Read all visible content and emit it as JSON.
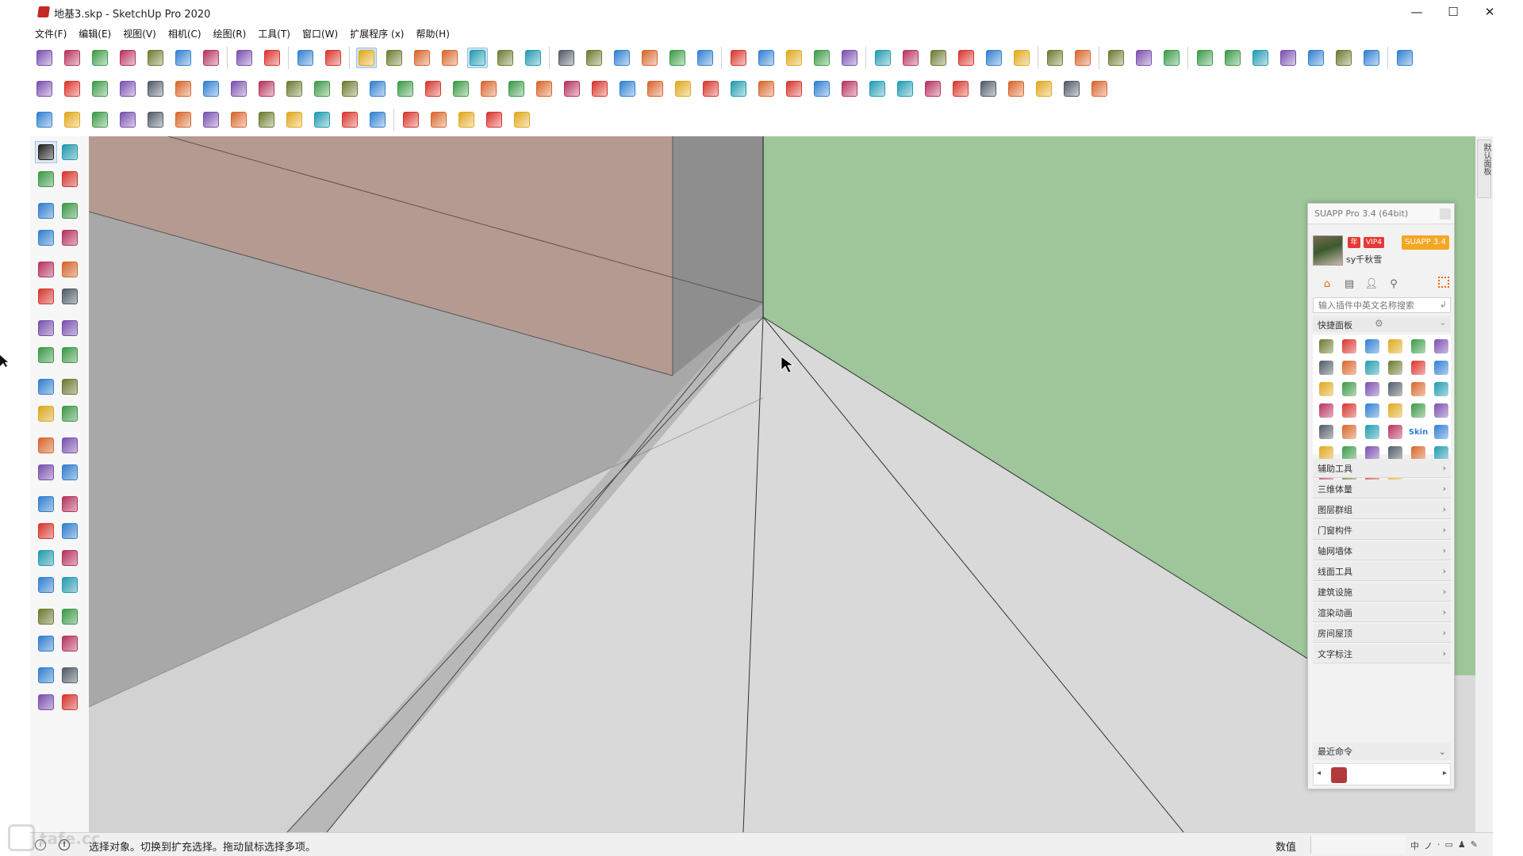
{
  "window": {
    "title": "地基3.skp - SketchUp Pro 2020",
    "minimize_glyph": "—",
    "maximize_glyph": "☐",
    "close_glyph": "✕"
  },
  "menu": [
    {
      "label": "文件(F)"
    },
    {
      "label": "编辑(E)"
    },
    {
      "label": "视图(V)"
    },
    {
      "label": "相机(C)"
    },
    {
      "label": "绘图(R)"
    },
    {
      "label": "工具(T)"
    },
    {
      "label": "窗口(W)"
    },
    {
      "label": "扩展程序 (x)"
    },
    {
      "label": "帮助(H)"
    }
  ],
  "toolbar_row1": [
    "new-icon",
    "open-icon",
    "save-icon",
    "cut-icon",
    "copy-icon",
    "paste-icon",
    "erase-icon",
    "sep",
    "undo-icon",
    "redo-icon",
    "sep",
    "print-icon",
    "model-info-icon",
    "sep",
    "xray-icon",
    "backedges-icon",
    "wireframe-icon",
    "hiddenline-icon",
    "shaded-icon",
    "textured-icon",
    "monochrome-icon",
    "sep",
    "iso-view-icon",
    "top-view-icon",
    "front-view-icon",
    "right-view-icon",
    "back-view-icon",
    "left-view-icon",
    "sep",
    "ruby-icon-1",
    "ruby-icon-2",
    "ruby-icon-3",
    "ruby-icon-4",
    "ruby-icon-5",
    "sep",
    "plugin-icon-1",
    "plugin-icon-2",
    "plugin-icon-3",
    "plugin-icon-4",
    "plugin-icon-5",
    "plugin-icon-6",
    "sep",
    "gear-icon",
    "grid-icon",
    "sep",
    "line-tool-icon",
    "dimension-icon",
    "flip-icon",
    "sep",
    "fill-icon",
    "box-icon",
    "shape-icon",
    "shape-icon-2",
    "pencil-icon",
    "scissors-icon",
    "wrench-icon",
    "sep",
    "corner-icon"
  ],
  "toolbar_row2": [
    "push-icon",
    "plane-icon",
    "plane-icon-2",
    "plane-icon-3",
    "plane-icon-4",
    "plane-icon-5",
    "rotate-icon",
    "rect-red-icon",
    "panel-icon",
    "frame-icon",
    "brick-icon",
    "connector-icon",
    "curve-icon",
    "path-icon",
    "plus-icon",
    "move-icon",
    "cross-icon",
    "cone-icon",
    "cone-icon-2",
    "triangle-icon",
    "arc-icon",
    "spiral-icon",
    "loop-icon",
    "star-icon",
    "box-icon-2",
    "loop-icon-2",
    "tree-icon",
    "paint-icon",
    "cube-icon",
    "cube-icon-2",
    "gem-icon",
    "array-icon",
    "screen-icon",
    "tile-icon",
    "tile-icon-2",
    "tile-icon-3",
    "scale-icon",
    "bezier-icon",
    "node-icon"
  ],
  "toolbar_row3": [
    "curve-a-icon",
    "curve-b-icon",
    "curve-c-icon",
    "curve-d-icon",
    "curve-e-icon",
    "curve-f-icon",
    "rect-icon",
    "spiral-b-icon",
    "arc-b-icon",
    "zigzag-icon",
    "hook-icon",
    "arc-c-icon",
    "arc-d-icon",
    "sep",
    "polyline-icon",
    "polygon-icon",
    "wrench-b-icon",
    "ellipse-icon",
    "sector-icon"
  ],
  "left_tools": [
    {
      "name": "select-icon",
      "active": true
    },
    {
      "name": "component-icon",
      "active": false
    },
    {
      "name": "paint-bucket-icon",
      "active": false
    },
    {
      "name": "eraser-icon",
      "active": false
    },
    {
      "name": "pencil-icon",
      "active": false
    },
    {
      "name": "freehand-icon",
      "active": false
    },
    {
      "name": "rectangle-icon",
      "active": false
    },
    {
      "name": "rotated-rect-icon",
      "active": false
    },
    {
      "name": "circle-icon",
      "active": false
    },
    {
      "name": "polygon-icon",
      "active": false
    },
    {
      "name": "arc-icon",
      "active": false
    },
    {
      "name": "arc-2pt-icon",
      "active": false
    },
    {
      "name": "arc-3pt-icon",
      "active": false
    },
    {
      "name": "pie-icon",
      "active": false
    },
    {
      "name": "move-icon",
      "active": false
    },
    {
      "name": "pushpull-icon",
      "active": false
    },
    {
      "name": "rotate-icon",
      "active": false
    },
    {
      "name": "followme-icon",
      "active": false
    },
    {
      "name": "scale-icon",
      "active": false
    },
    {
      "name": "offset-icon",
      "active": false
    },
    {
      "name": "tape-icon",
      "active": false
    },
    {
      "name": "dimension-icon",
      "active": false
    },
    {
      "name": "protractor-icon",
      "active": false
    },
    {
      "name": "text-icon",
      "active": false
    },
    {
      "name": "axes-icon",
      "active": false
    },
    {
      "name": "3dtext-icon",
      "active": false
    },
    {
      "name": "orbit-icon",
      "active": false
    },
    {
      "name": "pan-icon",
      "active": false
    },
    {
      "name": "zoom-icon",
      "active": false
    },
    {
      "name": "zoom-window-icon",
      "active": false
    },
    {
      "name": "zoom-extents-icon",
      "active": false
    },
    {
      "name": "previous-icon",
      "active": false
    },
    {
      "name": "position-camera-icon",
      "active": false
    },
    {
      "name": "look-around-icon",
      "active": false
    },
    {
      "name": "walk-icon",
      "active": false
    },
    {
      "name": "section-plane-icon",
      "active": false
    },
    {
      "name": "warehouse-icon",
      "active": false
    },
    {
      "name": "extension-warehouse-icon",
      "active": false
    },
    {
      "name": "layout-icon",
      "active": false
    },
    {
      "name": "ruby-gem-icon",
      "active": false
    }
  ],
  "colors": {
    "green_face": "#9ec69a",
    "pink_face": "#b59a92",
    "gray_face": "#c4c4c4",
    "accent_orange": "#f5a623",
    "brand_red": "#c62828"
  },
  "side_tab": {
    "label": "默认面板"
  },
  "suapp": {
    "title": "SUAPP Pro 3.4 (64bit)",
    "badge_a": "年",
    "badge_b": "VIP4",
    "version_badge": "SUAPP 3.4",
    "username": "sy千秋雪",
    "search_placeholder": "输入插件中英文名称搜索",
    "search_enter_glyph": "↲",
    "quick_panel_label": "快捷面板",
    "quick_gear_glyph": "⚙",
    "chevron_down": "⌄",
    "tab_icons": [
      "home-icon",
      "panel-icon",
      "user-icon",
      "search-icon"
    ],
    "plugin_icons": [
      "p01",
      "p02",
      "p03",
      "p04",
      "p05",
      "p06",
      "p07",
      "p08",
      "p09",
      "p10",
      "p11",
      "p12",
      "p13",
      "p14",
      "p15",
      "p16",
      "p17",
      "p18",
      "p19",
      "p20",
      "p21",
      "p22",
      "p23",
      "p24",
      "p25",
      "p26",
      "p27",
      "p28",
      "p29",
      "p30",
      "p31",
      "p32",
      "p33",
      "p34",
      "p35",
      "p36",
      "p37",
      "p38",
      "p39",
      "p40"
    ],
    "plugin_skin_label": "Skin",
    "categories": [
      {
        "label": "辅助工具",
        "arrow": "›"
      },
      {
        "label": "三维体量",
        "arrow": "›"
      },
      {
        "label": "图层群组",
        "arrow": "›"
      },
      {
        "label": "门窗构件",
        "arrow": "›"
      },
      {
        "label": "轴网墙体",
        "arrow": "›"
      },
      {
        "label": "线面工具",
        "arrow": "›"
      },
      {
        "label": "建筑设施",
        "arrow": "›"
      },
      {
        "label": "渲染动画",
        "arrow": "›"
      },
      {
        "label": "房间屋顶",
        "arrow": "›"
      },
      {
        "label": "文字标注",
        "arrow": "›"
      }
    ],
    "recent_label": "最近命令",
    "recent_left": "◂",
    "recent_right": "▸"
  },
  "status": {
    "hint": "选择对象。切换到扩充选择。拖动鼠标选择多项。",
    "measurements_label": "数值",
    "measurements_value": "",
    "tray_items": [
      "中",
      "ノ",
      "·",
      "▭",
      "♟",
      "✎"
    ]
  },
  "watermark_text": "tafe.cc"
}
